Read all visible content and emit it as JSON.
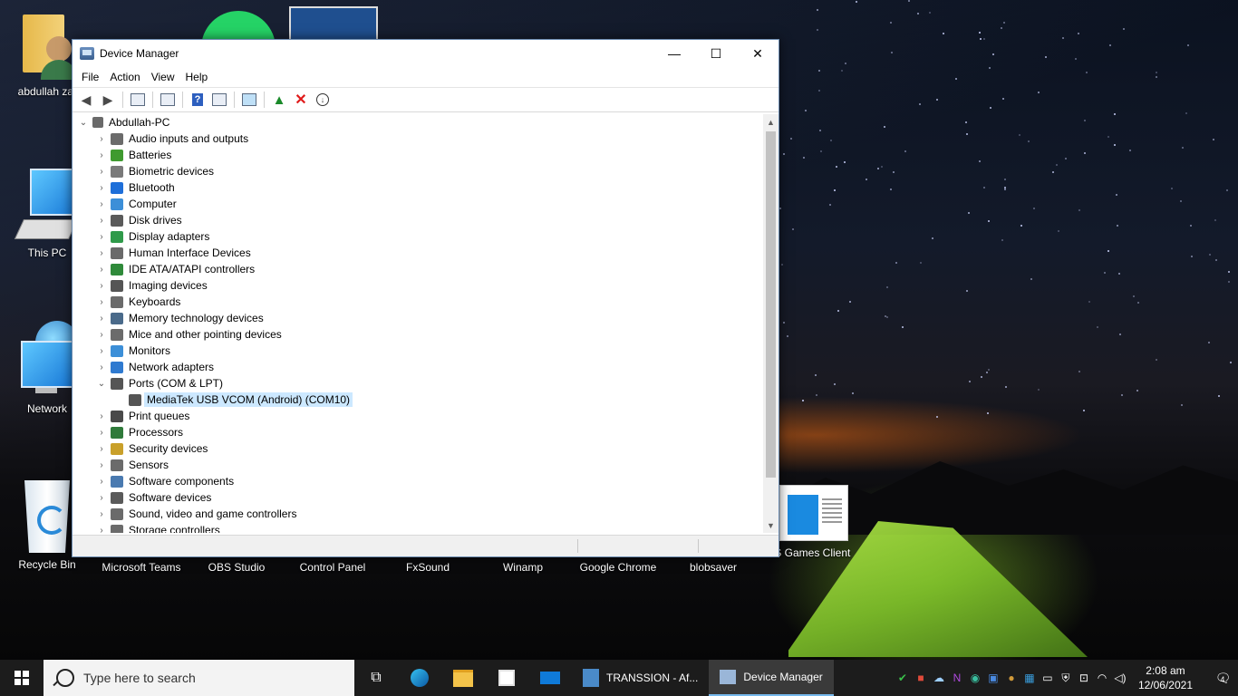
{
  "desktop": {
    "icons": [
      {
        "label": "abdullah zaf",
        "icon": "user-folder-icon"
      },
      {
        "label": "This PC",
        "icon": "computer-icon"
      },
      {
        "label": "Network",
        "icon": "network-globe-icon"
      },
      {
        "label": "Recycle Bin",
        "icon": "recycle-bin-icon"
      },
      {
        "label": "Microsoft Teams",
        "icon": "teams-icon"
      },
      {
        "label": "OBS Studio",
        "icon": "obs-icon"
      },
      {
        "label": "Control Panel",
        "icon": "control-panel-icon"
      },
      {
        "label": "FxSound",
        "icon": "fxsound-icon"
      },
      {
        "label": "Winamp",
        "icon": "winamp-icon"
      },
      {
        "label": "Google Chrome",
        "icon": "chrome-icon"
      },
      {
        "label": "blobsaver",
        "icon": "blobsaver-icon"
      },
      {
        "label": "RS Games Client",
        "icon": "rs-games-icon"
      }
    ]
  },
  "window": {
    "title": "Device Manager",
    "controls": {
      "minimize": "—",
      "maximize": "☐",
      "close": "✕"
    },
    "menu": [
      "File",
      "Action",
      "View",
      "Help"
    ],
    "toolbar": [
      "back-arrow-icon",
      "forward-arrow-icon",
      "properties-icon",
      "list-icon",
      "help-icon",
      "view-icon",
      "monitor-icon",
      "update-driver-icon",
      "uninstall-icon",
      "download-icon"
    ]
  },
  "tree": {
    "root": "Abdullah-PC",
    "categories": [
      {
        "label": "Audio inputs and outputs",
        "color": "#6b6b6b"
      },
      {
        "label": "Batteries",
        "color": "#3f9a2f"
      },
      {
        "label": "Biometric devices",
        "color": "#7a7a7a"
      },
      {
        "label": "Bluetooth",
        "color": "#1e6fd9"
      },
      {
        "label": "Computer",
        "color": "#3c8fd8"
      },
      {
        "label": "Disk drives",
        "color": "#5a5a5a"
      },
      {
        "label": "Display adapters",
        "color": "#2f9a4a"
      },
      {
        "label": "Human Interface Devices",
        "color": "#6a6a6a"
      },
      {
        "label": "IDE ATA/ATAPI controllers",
        "color": "#2f8a3a"
      },
      {
        "label": "Imaging devices",
        "color": "#555555"
      },
      {
        "label": "Keyboards",
        "color": "#6b6b6b"
      },
      {
        "label": "Memory technology devices",
        "color": "#4a6a8a"
      },
      {
        "label": "Mice and other pointing devices",
        "color": "#6b6b6b"
      },
      {
        "label": "Monitors",
        "color": "#3c8fd8"
      },
      {
        "label": "Network adapters",
        "color": "#2f7ad0"
      },
      {
        "label": "Ports (COM & LPT)",
        "color": "#555555",
        "expanded": true
      },
      {
        "label": "Print queues",
        "color": "#4a4a4a"
      },
      {
        "label": "Processors",
        "color": "#2f7a3a"
      },
      {
        "label": "Security devices",
        "color": "#c9a02a"
      },
      {
        "label": "Sensors",
        "color": "#6b6b6b"
      },
      {
        "label": "Software components",
        "color": "#4a7ab0"
      },
      {
        "label": "Software devices",
        "color": "#5a5a5a"
      },
      {
        "label": "Sound, video and game controllers",
        "color": "#6b6b6b"
      },
      {
        "label": "Storage controllers",
        "color": "#6b6b6b"
      }
    ],
    "expanded_child": {
      "parent": "Ports (COM & LPT)",
      "label": "MediaTek USB VCOM (Android) (COM10)",
      "color": "#555555"
    }
  },
  "taskbar": {
    "search_placeholder": "Type here to search",
    "pinned": [
      "task-view-icon",
      "edge-icon",
      "file-explorer-icon",
      "store-icon",
      "mail-icon"
    ],
    "apps": [
      {
        "label": "TRANSSION - Af...",
        "active": false
      },
      {
        "label": "Device Manager",
        "active": true
      }
    ],
    "tray_icons": [
      "shield-check-icon",
      "tool-icon",
      "cloud-icon",
      "onenote-icon",
      "globe-icon",
      "app-icon",
      "mail-tray-icon",
      "network-tray-icon",
      "display-icon",
      "security-icon",
      "network-icon",
      "wifi-icon",
      "volume-icon"
    ],
    "time": "2:08 am",
    "date": "12/06/2021",
    "notifications": "4"
  }
}
